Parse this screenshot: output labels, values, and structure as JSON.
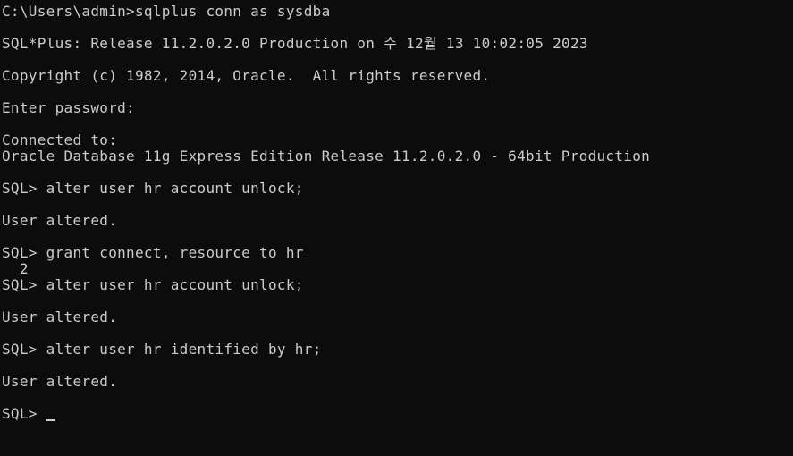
{
  "terminal": {
    "lines": [
      "C:\\Users\\admin>sqlplus conn as sysdba",
      "",
      "SQL*Plus: Release 11.2.0.2.0 Production on 수 12월 13 10:02:05 2023",
      "",
      "Copyright (c) 1982, 2014, Oracle.  All rights reserved.",
      "",
      "Enter password:",
      "",
      "Connected to:",
      "Oracle Database 11g Express Edition Release 11.2.0.2.0 - 64bit Production",
      "",
      "SQL> alter user hr account unlock;",
      "",
      "User altered.",
      "",
      "SQL> grant connect, resource to hr",
      "  2",
      "SQL> alter user hr account unlock;",
      "",
      "User altered.",
      "",
      "SQL> alter user hr identified by hr;",
      "",
      "User altered.",
      "",
      "SQL> "
    ]
  }
}
